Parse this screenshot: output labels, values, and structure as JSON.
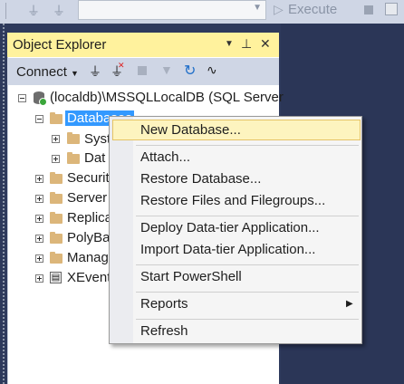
{
  "toolbar": {
    "execute_label": "Execute"
  },
  "object_explorer": {
    "title": "Object Explorer",
    "title_buttons": {
      "dropdown": "▾",
      "pin": "📌",
      "close": "✕"
    },
    "connect_label": "Connect",
    "tree": {
      "server": "(localdb)\\MSSQLLocalDB (SQL Server",
      "databases": "Databases",
      "system_databases": "Syst",
      "database_snapshots": "Dat",
      "security": "Securit",
      "server_objects": "Server",
      "replication": "Replica",
      "polybase": "PolyBa",
      "management": "Manag",
      "xevent": "XEvent"
    }
  },
  "context_menu": {
    "items": [
      "New Database...",
      "Attach...",
      "Restore Database...",
      "Restore Files and Filegroups...",
      "Deploy Data-tier Application...",
      "Import Data-tier Application...",
      "Start PowerShell",
      "Reports",
      "Refresh"
    ],
    "submenu_arrow": "▶"
  },
  "colors": {
    "title_bar": "#fff29d",
    "selection": "#3399ff",
    "menu_highlight": "#fdf4bf",
    "dark_area": "#2b3657"
  },
  "icons": [
    "connect-plug-icon",
    "disconnect-plug-icon",
    "stop-icon",
    "filter-icon",
    "refresh-icon",
    "activity-monitor-icon",
    "database-server-icon",
    "folder-icon"
  ]
}
